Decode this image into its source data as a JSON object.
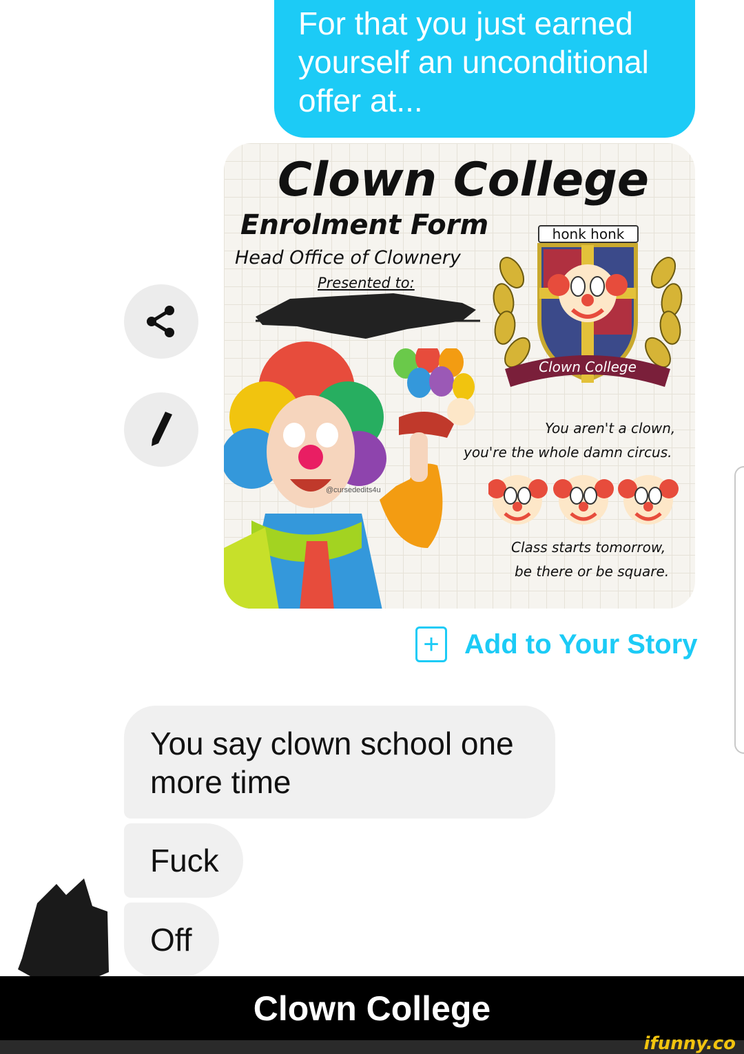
{
  "conversation": {
    "sent_message": "For that you just earned yourself an unconditional offer at...",
    "received_messages": [
      "You say clown school one more time",
      "Fuck",
      "Off"
    ]
  },
  "side_buttons": {
    "share_icon": "share-icon",
    "edit_icon": "pencil-icon"
  },
  "image_card": {
    "title": "Clown College",
    "subtitle": "Enrolment Form",
    "office": "Head Office of Clownery",
    "presented_to": "Presented to:",
    "badge": "honk honk",
    "crest_banner": "Clown College",
    "quote_line1": "You aren't a clown,",
    "quote_line2": "you're the whole damn circus.",
    "class_line1": "Class starts tomorrow,",
    "class_line2": "be there or be square.",
    "photo_watermark": "@cursededits4u"
  },
  "story_action": {
    "label": "Add to Your Story",
    "icon": "plus-square-icon"
  },
  "caption": "Clown College",
  "site_watermark": "ifunny.co",
  "colors": {
    "accent": "#1ccbf6",
    "received_bubble": "#f0f0f0",
    "caption_bg": "#000000"
  }
}
